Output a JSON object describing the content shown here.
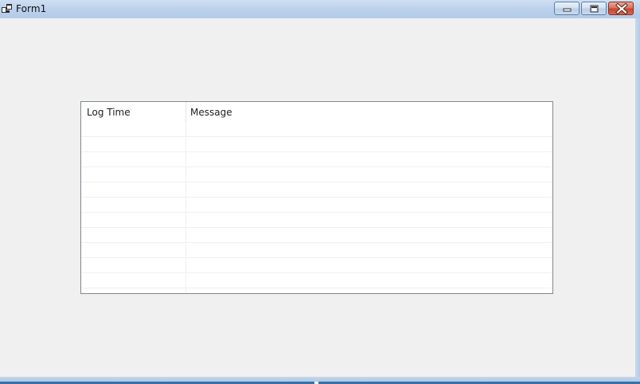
{
  "window": {
    "title": "Form1",
    "icon": "app-window-icon",
    "buttons": {
      "minimize": "minimize-icon",
      "maximize": "maximize-icon",
      "close": "close-icon"
    }
  },
  "listview": {
    "columns": [
      {
        "label": "Log Time"
      },
      {
        "label": "Message"
      }
    ],
    "rows": []
  },
  "colors": {
    "client_background": "#f0f0f0",
    "close_button": "#c6452e",
    "list_border": "#828790"
  }
}
